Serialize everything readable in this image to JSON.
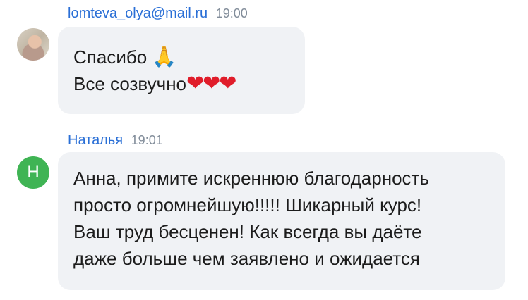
{
  "messages": [
    {
      "sender": "lomteva_olya@mail.ru",
      "time": "19:00",
      "avatar_icon": "user-photo",
      "lines": [
        {
          "text": "Спасибо ",
          "emoji": "🙏"
        },
        {
          "text": "Все созвучно",
          "emoji": "❤❤❤"
        }
      ]
    },
    {
      "sender": "Наталья",
      "time": "19:01",
      "avatar_letter": "Н",
      "lines": [
        {
          "text": "Анна, примите искреннюю благодарность"
        },
        {
          "text": "просто огромнейшую!!!!! Шикарный курс!"
        },
        {
          "text": "Ваш труд бесценен! Как всегда вы даёте"
        },
        {
          "text": "даже больше  чем заявлено и ожидается"
        }
      ]
    }
  ],
  "colors": {
    "sender_name": "#2a6fd6",
    "time": "#818c99",
    "bubble_bg": "#f0f2f5",
    "avatar_letter_bg": "#3fb454"
  }
}
